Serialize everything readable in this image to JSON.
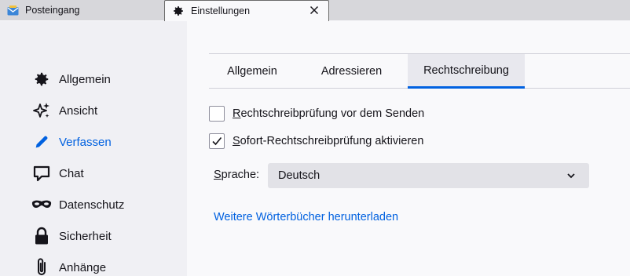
{
  "tabs": [
    {
      "label": "Posteingang",
      "icon": "mail-icon"
    },
    {
      "label": "Einstellungen",
      "icon": "gear-icon",
      "close_icon": "close-icon"
    }
  ],
  "sidebar": {
    "items": [
      {
        "label": "Allgemein",
        "icon": "gear-icon"
      },
      {
        "label": "Ansicht",
        "icon": "sparkle-icon"
      },
      {
        "label": "Verfassen",
        "icon": "pencil-icon",
        "active": true
      },
      {
        "label": "Chat",
        "icon": "chat-bubble-icon"
      },
      {
        "label": "Datenschutz",
        "icon": "mask-icon"
      },
      {
        "label": "Sicherheit",
        "icon": "lock-icon"
      },
      {
        "label": "Anhänge",
        "icon": "paperclip-icon"
      }
    ]
  },
  "subtabs": [
    {
      "label": "Allgemein"
    },
    {
      "label": "Adressieren"
    },
    {
      "label": "Rechtschreibung",
      "active": true
    }
  ],
  "spelling": {
    "check_before_send": {
      "mnemonic": "R",
      "rest": "echtschreibprüfung vor dem Senden",
      "checked": false
    },
    "instant_check": {
      "mnemonic": "S",
      "rest": "ofort-Rechtschreibprüfung aktivieren",
      "checked": true
    },
    "language_label_mnemonic": "S",
    "language_label_rest": "prache:",
    "language_value": "Deutsch",
    "download_link": "Weitere Wörterbücher herunterladen"
  },
  "colors": {
    "accent": "#0061e0",
    "sidebar_bg": "#f0f0f4",
    "tabbar_bg": "#d7d7db"
  }
}
